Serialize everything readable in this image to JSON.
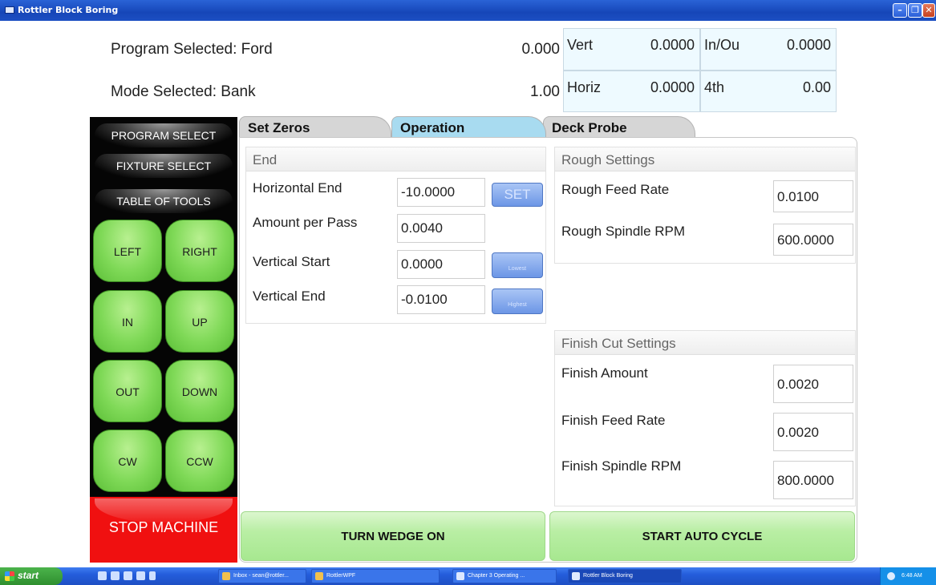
{
  "window": {
    "title": "Rottler Block Boring"
  },
  "header": {
    "program_label": "Program Selected: Ford",
    "mode_label": "Mode Selected: Bank",
    "readout_top": "0.000",
    "readout_bottom": "1.00",
    "axes": {
      "vert": {
        "label": "Vert",
        "value": "0.0000"
      },
      "inout": {
        "label": "In/Ou",
        "value": "0.0000"
      },
      "horiz": {
        "label": "Horiz",
        "value": "0.0000"
      },
      "fourth": {
        "label": "4th",
        "value": "0.00"
      }
    }
  },
  "left_panel": {
    "program_select": "PROGRAM SELECT",
    "fixture_select": "FIXTURE SELECT",
    "table_of_tools": "TABLE OF TOOLS",
    "jog": {
      "left": "LEFT",
      "right": "RIGHT",
      "in": "IN",
      "up": "UP",
      "out": "OUT",
      "down": "DOWN",
      "cw": "CW",
      "ccw": "CCW"
    },
    "stop": "STOP MACHINE"
  },
  "tabs": {
    "set_zeros": "Set Zeros",
    "operation": "Operation",
    "deck_probe": "Deck Probe",
    "active": "Operation"
  },
  "end_group": {
    "title": "End",
    "horizontal_end": {
      "label": "Horizontal End",
      "value": "-10.0000",
      "button": "SET"
    },
    "amount_per_pass": {
      "label": "Amount per Pass",
      "value": "0.0040"
    },
    "vertical_start": {
      "label": "Vertical Start",
      "value": "0.0000",
      "button": "Lowest"
    },
    "vertical_end": {
      "label": "Vertical End",
      "value": "-0.0100",
      "button": "Highest"
    }
  },
  "rough_group": {
    "title": "Rough Settings",
    "feed_rate": {
      "label": "Rough Feed Rate",
      "value": "0.0100"
    },
    "spindle_rpm": {
      "label": "Rough Spindle RPM",
      "value": "600.0000"
    }
  },
  "finish_group": {
    "title": "Finish Cut Settings",
    "amount": {
      "label": "Finish Amount",
      "value": "0.0020"
    },
    "feed_rate": {
      "label": "Finish Feed Rate",
      "value": "0.0020"
    },
    "spindle_rpm": {
      "label": "Finish Spindle RPM",
      "value": "800.0000"
    }
  },
  "actions": {
    "turn_wedge_on": "TURN WEDGE ON",
    "start_auto_cycle": "START AUTO CYCLE"
  },
  "taskbar": {
    "start": "start",
    "tasks": [
      "Inbox - sean@rottler...",
      "RottlerWPF",
      "Chapter 3 Operating ...",
      "Rottler Block Boring"
    ],
    "clock": "6:48 AM"
  },
  "colors": {
    "titlebar": "#1c4fc2",
    "readout_cell": "#eefaff",
    "active_tab": "#a8dbf0",
    "jog_button": "#7fd957",
    "stop": "#f01010",
    "action_button": "#b9eea4"
  }
}
